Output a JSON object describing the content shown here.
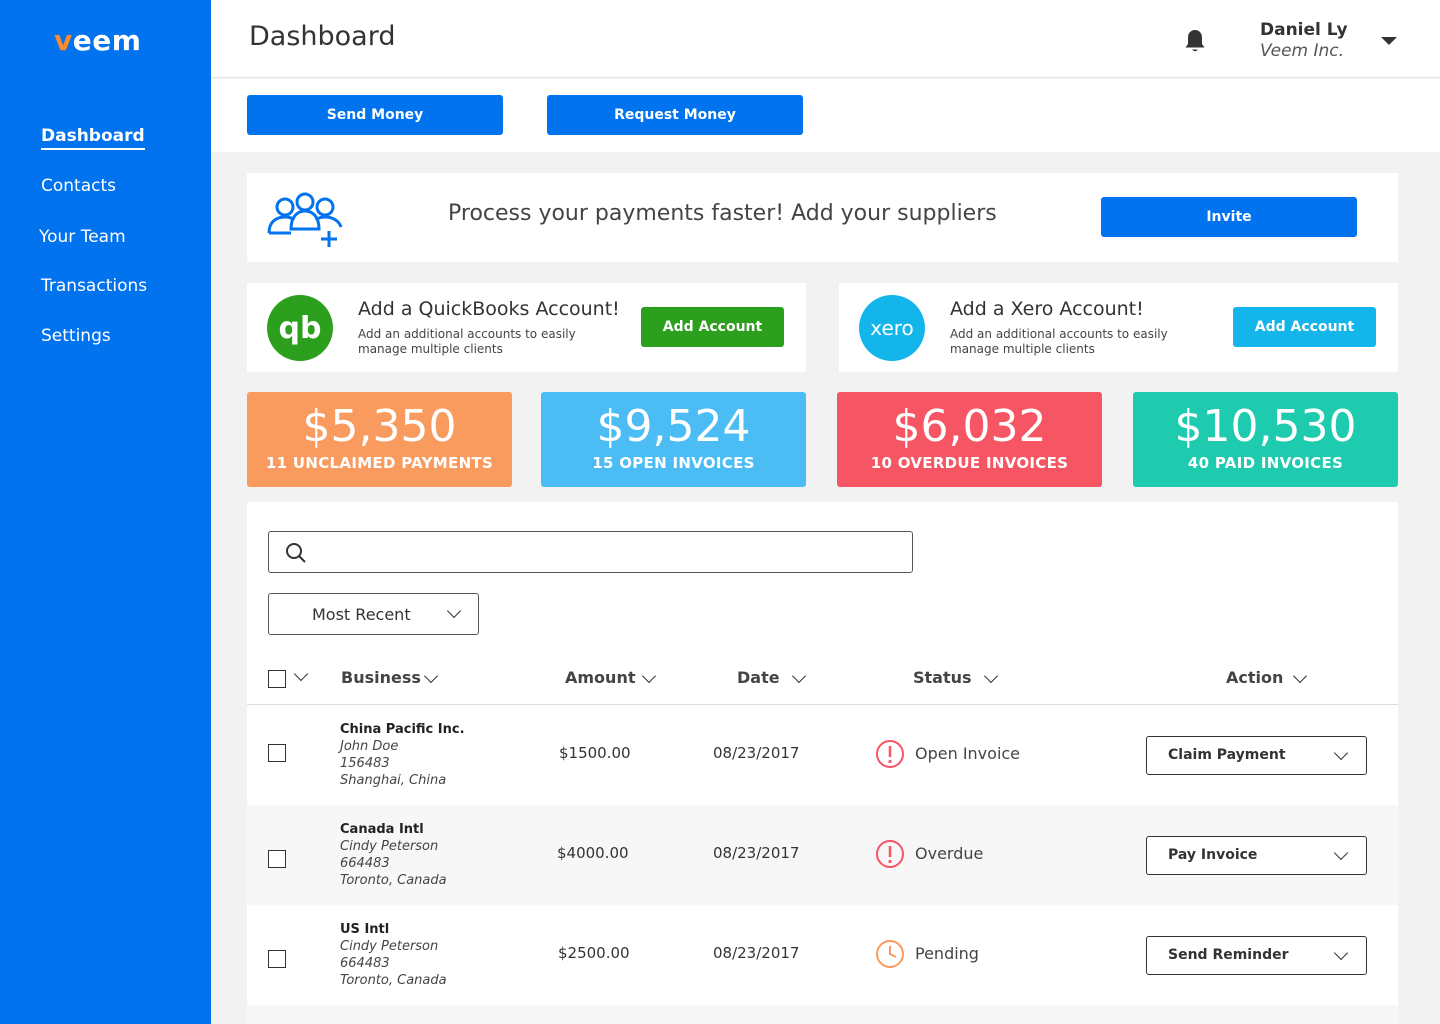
{
  "brand": {
    "logo_v": "v",
    "logo_rest": "eem"
  },
  "sidebar": {
    "items": [
      {
        "label": "Dashboard"
      },
      {
        "label": "Contacts"
      },
      {
        "label": "Your Team"
      },
      {
        "label": "Transactions"
      },
      {
        "label": "Settings"
      }
    ]
  },
  "header": {
    "title": "Dashboard",
    "user_name": "Daniel Ly",
    "user_org": "Veem Inc."
  },
  "actions": {
    "send_money": "Send Money",
    "request_money": "Request Money"
  },
  "invite": {
    "text": "Process your payments faster! Add your suppliers",
    "button": "Invite"
  },
  "integrations": {
    "quickbooks": {
      "logo": "qb",
      "title": "Add a QuickBooks Account!",
      "desc": "Add an additional accounts to easily manage multiple  clients",
      "button": "Add Account",
      "color": "#2ca01c"
    },
    "xero": {
      "logo": "xero",
      "title": "Add a Xero Account!",
      "desc": "Add an additional accounts to easily manage multiple  clients",
      "button": "Add Account",
      "color": "#13b5ea"
    }
  },
  "stats": [
    {
      "amount": "$5,350",
      "label": "11 UNCLAIMED PAYMENTS",
      "color": "#f99b5f"
    },
    {
      "amount": "$9,524",
      "label": "15 OPEN INVOICES",
      "color": "#4cbcf5"
    },
    {
      "amount": "$6,032",
      "label": "10 OVERDUE INVOICES",
      "color": "#f65563"
    },
    {
      "amount": "$10,530",
      "label": "40 PAID INVOICES",
      "color": "#1ecbae"
    }
  ],
  "search": {
    "placeholder": "",
    "value": ""
  },
  "sort": {
    "selected": "Most Recent"
  },
  "table": {
    "columns": {
      "business": "Business",
      "amount": "Amount",
      "date": "Date",
      "status": "Status",
      "action": "Action"
    },
    "rows": [
      {
        "business": "China Pacific Inc.",
        "contact": "John Doe",
        "id": "156483",
        "location": "Shanghai, China",
        "amount": "$1500.00",
        "date": "08/23/2017",
        "status": "Open Invoice",
        "status_icon": "alert-circle-icon",
        "action": "Claim Payment"
      },
      {
        "business": "Canada Intl",
        "contact": "Cindy Peterson",
        "id": "664483",
        "location": "Toronto, Canada",
        "amount": "$4000.00",
        "date": "08/23/2017",
        "status": "Overdue",
        "status_icon": "alert-circle-icon",
        "action": "Pay Invoice"
      },
      {
        "business": "US Intl",
        "contact": "Cindy Peterson",
        "id": "664483",
        "location": "Toronto, Canada",
        "amount": "$2500.00",
        "date": "08/23/2017",
        "status": "Pending",
        "status_icon": "clock-icon",
        "action": "Send Reminder"
      }
    ]
  },
  "colors": {
    "primary": "#0273ee",
    "alert": "#f65563",
    "pending": "#f99b5f"
  }
}
